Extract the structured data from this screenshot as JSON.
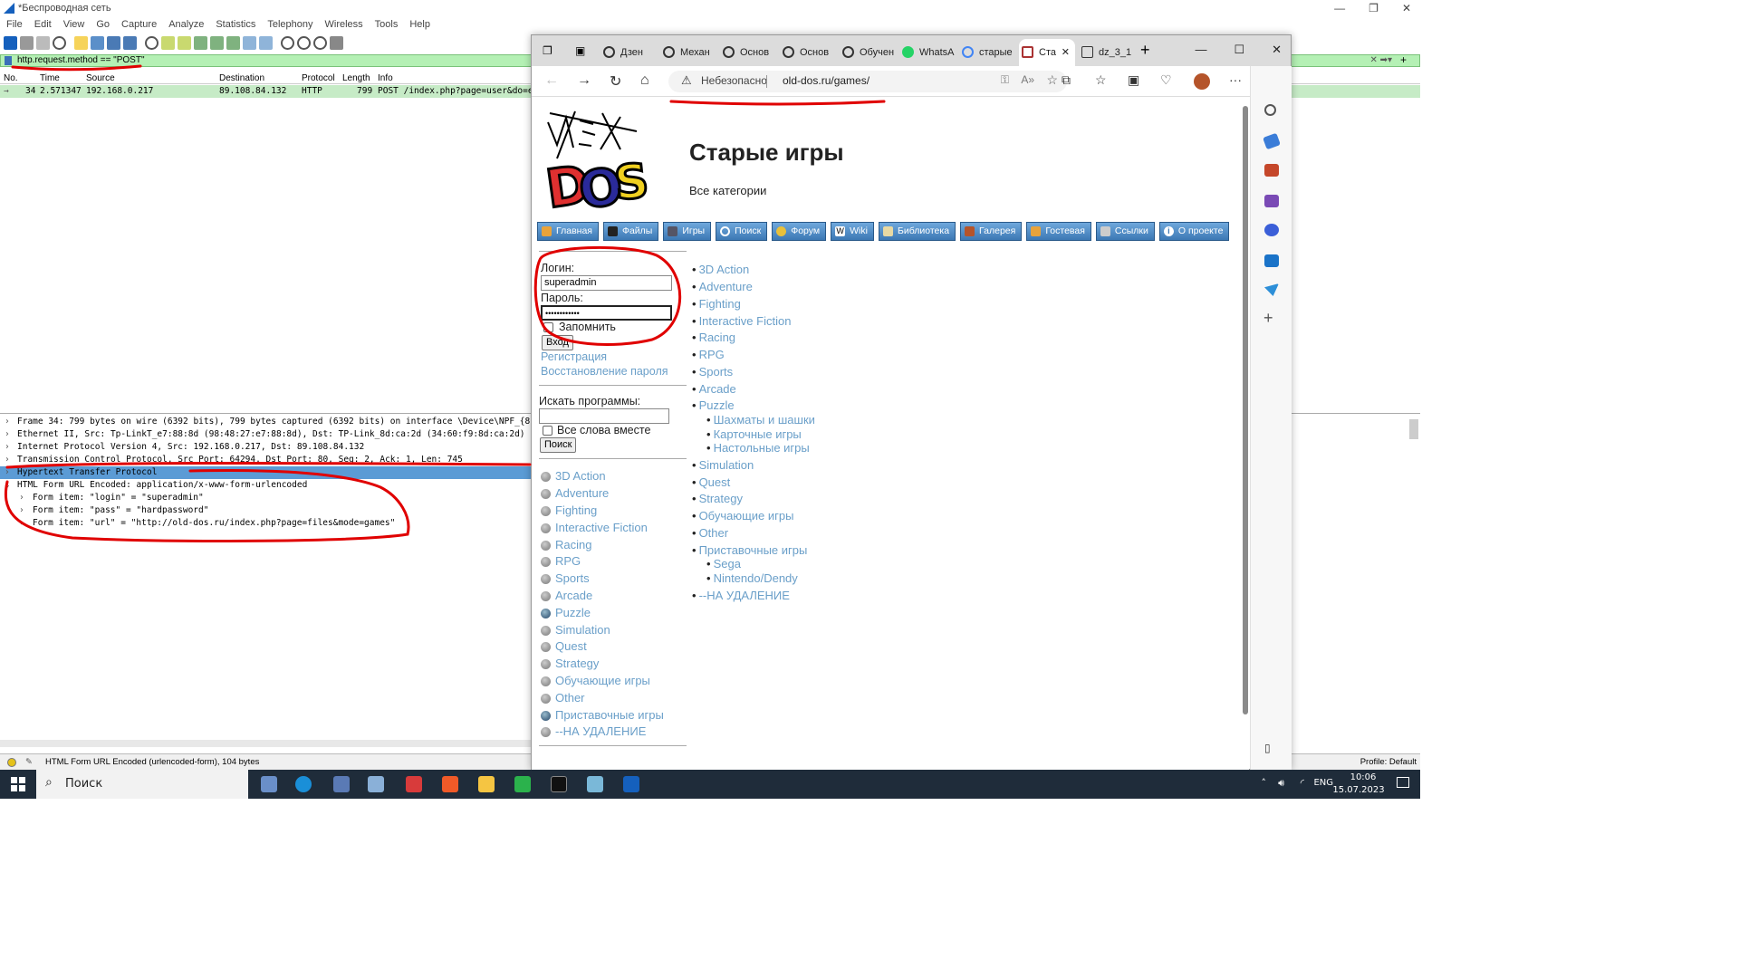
{
  "wireshark": {
    "title": "*Беспроводная сеть",
    "menu": [
      "File",
      "Edit",
      "View",
      "Go",
      "Capture",
      "Analyze",
      "Statistics",
      "Telephony",
      "Wireless",
      "Tools",
      "Help"
    ],
    "filter": "http.request.method == \"POST\"",
    "columns": [
      "No.",
      "Time",
      "Source",
      "Destination",
      "Protocol",
      "Length",
      "Info"
    ],
    "packet": {
      "no": "34",
      "time": "2.571347",
      "source": "192.168.0.217",
      "destination": "89.108.84.132",
      "protocol": "HTTP",
      "length": "799",
      "info": "POST /index.php?page=user&do=e"
    },
    "details": [
      "Frame 34: 799 bytes on wire (6392 bits), 799 bytes captured (6392 bits) on interface \\Device\\NPF_{8",
      "Ethernet II, Src: Tp-LinkT_e7:88:8d (98:48:27:e7:88:8d), Dst: TP-Link_8d:ca:2d (34:60:f9:8d:ca:2d)",
      "Internet Protocol Version 4, Src: 192.168.0.217, Dst: 89.108.84.132",
      "Transmission Control Protocol, Src Port: 64294, Dst Port: 80, Seq: 2, Ack: 1, Len: 745",
      "Hypertext Transfer Protocol",
      "HTML Form URL Encoded: application/x-www-form-urlencoded"
    ],
    "form_items": [
      "Form item: \"login\" = \"superadmin\"",
      "Form item: \"pass\" = \"hardpassword\"",
      "Form item: \"url\" = \"http://old-dos.ru/index.php?page=files&mode=games\""
    ],
    "status": "HTML Form URL Encoded (urlencoded-form), 104 bytes",
    "profile": "Profile: Default"
  },
  "browser": {
    "tabs": [
      "Дзен",
      "Механ",
      "Основ",
      "Основ",
      "Обучен",
      "WhatsA",
      "старые",
      "Ста",
      "dz_3_1"
    ],
    "security": "Небезопасно",
    "url": "old-dos.ru/games/"
  },
  "site": {
    "title": "Старые игры",
    "subtitle": "Все категории",
    "nav": [
      "Главная",
      "Файлы",
      "Игры",
      "Поиск",
      "Форум",
      "Wiki",
      "Библиотека",
      "Галерея",
      "Гостевая",
      "Ссылки",
      "О проекте"
    ],
    "login": {
      "login_label": "Логин:",
      "login_value": "superadmin",
      "pass_label": "Пароль:",
      "pass_value": "••••••••••••",
      "remember": "Запомнить",
      "submit": "Вход",
      "register": "Регистрация",
      "recover": "Восстановление пароля"
    },
    "search": {
      "label": "Искать программы:",
      "all_words": "Все слова вместе",
      "button": "Поиск"
    },
    "side_categories": [
      "3D Action",
      "Adventure",
      "Fighting",
      "Interactive Fiction",
      "Racing",
      "RPG",
      "Sports",
      "Arcade",
      "Puzzle",
      "Simulation",
      "Quest",
      "Strategy",
      "Обучающие игры",
      "Other",
      "Приставочные игры",
      "--НА УДАЛЕНИЕ"
    ],
    "main_categories": [
      "3D Action",
      "Adventure",
      "Fighting",
      "Interactive Fiction",
      "Racing",
      "RPG",
      "Sports",
      "Arcade",
      "Puzzle",
      "Simulation",
      "Quest",
      "Strategy",
      "Обучающие игры",
      "Other",
      "Приставочные игры",
      "--НА УДАЛЕНИЕ"
    ],
    "puzzle_sub": [
      "Шахматы и шашки",
      "Карточные игры",
      "Настольные игры"
    ],
    "console_sub": [
      "Sega",
      "Nintendo/Dendy"
    ]
  },
  "taskbar": {
    "search": "Поиск",
    "lang": "ENG",
    "time": "10:06",
    "date": "15.07.2023"
  }
}
